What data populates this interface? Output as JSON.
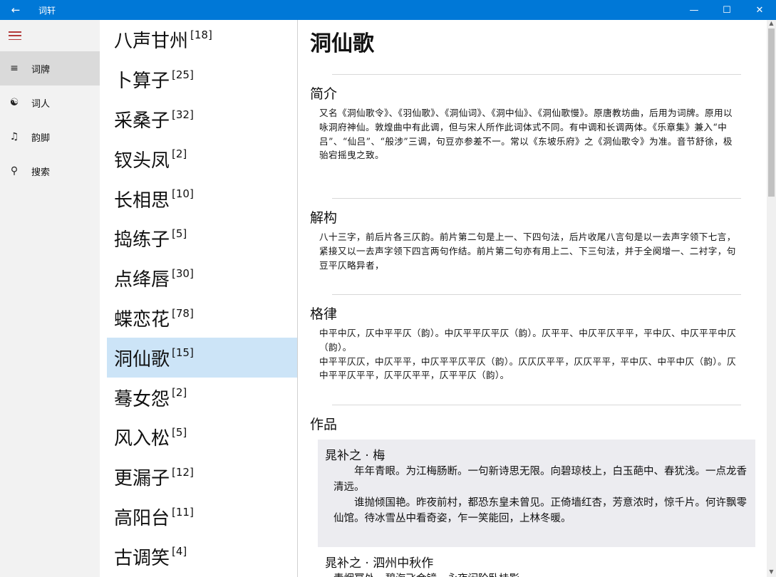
{
  "app": {
    "title": "词轩"
  },
  "nav": {
    "items": [
      {
        "label": "词牌",
        "icon": "list-icon"
      },
      {
        "label": "词人",
        "icon": "people-list-icon"
      },
      {
        "label": "韵脚",
        "icon": "music-list-icon"
      },
      {
        "label": "搜索",
        "icon": "search-icon"
      }
    ],
    "active_index": 0
  },
  "list": {
    "items": [
      {
        "name": "八声甘州",
        "count": "[18]"
      },
      {
        "name": "卜算子",
        "count": "[25]"
      },
      {
        "name": "采桑子",
        "count": "[32]"
      },
      {
        "name": "钗头凤",
        "count": "[2]"
      },
      {
        "name": "长相思",
        "count": "[10]"
      },
      {
        "name": "捣练子",
        "count": "[5]"
      },
      {
        "name": "点绛唇",
        "count": "[30]"
      },
      {
        "name": "蝶恋花",
        "count": "[78]"
      },
      {
        "name": "洞仙歌",
        "count": "[15]"
      },
      {
        "name": "蓦女怨",
        "count": "[2]"
      },
      {
        "name": "风入松",
        "count": "[5]"
      },
      {
        "name": "更漏子",
        "count": "[12]"
      },
      {
        "name": "高阳台",
        "count": "[11]"
      },
      {
        "name": "古调笑",
        "count": "[4]"
      }
    ],
    "selected_index": 8
  },
  "detail": {
    "title": "洞仙歌",
    "intro_heading": "简介",
    "intro_text": "又名《洞仙歌令》、《羽仙歌》、《洞仙词》、《洞中仙》、《洞仙歌慢》。原唐教坊曲，后用为词牌。原用以咏洞府神仙。敦煌曲中有此调，但与宋人所作此词体式不同。有中调和长调两体。《乐章集》兼入“中吕”、“仙吕”、“般涉”三调，句豆亦参差不一。常以《东坡乐府》之《洞仙歌令》为准。音节舒徐，极骀宕摇曳之致。",
    "structure_heading": "解构",
    "structure_text": "八十三字，前后片各三仄韵。前片第二句是上一、下四句法，后片收尾八言句是以一去声字领下七言，紧接又以一去声字领下四言两句作结。前片第二句亦有用上二、下三句法，并于全阕增一、二衬字，句豆平仄略异者，",
    "meter_heading": "格律",
    "meter_line1": "中平中仄，仄中平平仄（韵）。中仄平平仄平仄（韵）。仄平平、中仄平仄平平，平中仄、中仄平平中仄（韵）。",
    "meter_line2": "中平平仄仄，中仄平平，中仄平平仄平仄（韵）。仄仄仄平平，仄仄平平，平中仄、中平中仄（韵）。仄中平平仄平平，仄平仄平平，仄平平仄（韵）。",
    "works_heading": "作品",
    "work1": {
      "title": "晁补之 · 梅",
      "p1": "年年青眼。为江梅肠断。一句新诗思无限。向碧琼枝上，白玉葩中、春犹浅。一点龙香清远。",
      "p2": "谁抛倾国艳。昨夜前村，都恐东皇未曾见。正倚墙红杏，芳意浓时，惊千片。何许飘零仙馆。待冰雪丛中看奇姿，乍一笑能回，上林冬暖。"
    },
    "work2": {
      "title": "晁补之 · 泗州中秋作",
      "first_line": "青烟幂处，碧海飞金镜。永夜闲阶卧桂影。"
    }
  }
}
